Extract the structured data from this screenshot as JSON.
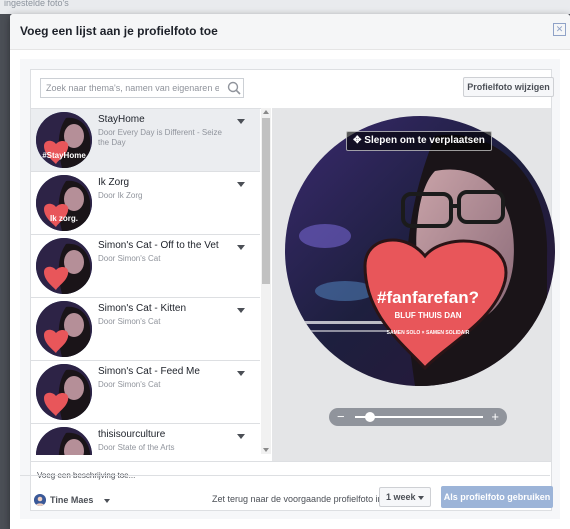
{
  "backdrop": {
    "text": "ingestelde foto's"
  },
  "dialog": {
    "title": "Voeg een lijst aan je profielfoto toe",
    "close_glyph": "✕"
  },
  "search": {
    "placeholder": "Zoek naar thema's, namen van eigenaren en meer"
  },
  "change_photo_button": "Profielfoto wijzigen",
  "frames": [
    {
      "title": "StayHome",
      "subtitle": "Door Every Day is Different - Seize the Day",
      "badge": "#StayHome",
      "selected": true
    },
    {
      "title": "Ik Zorg",
      "subtitle": "Door Ik Zorg",
      "badge": "Ik zorg.",
      "selected": false
    },
    {
      "title": "Simon's Cat - Off to the Vet",
      "subtitle": "Door Simon's Cat",
      "badge": "",
      "selected": false
    },
    {
      "title": "Simon's Cat - Kitten",
      "subtitle": "Door Simon's Cat",
      "badge": "",
      "selected": false
    },
    {
      "title": "Simon's Cat - Feed Me",
      "subtitle": "Door Simon's Cat",
      "badge": "",
      "selected": false
    },
    {
      "title": "thisisourculture",
      "subtitle": "Door State of the Arts",
      "badge": "",
      "selected": false
    }
  ],
  "preview": {
    "drag_label": "Slepen om te verplaatsen",
    "drag_glyph": "✥",
    "heart_title": "#fanfarefan?",
    "heart_subtitle": "BLUF THUIS DAN",
    "heart_tagline": "SAMEN SOLO × SAMEN SOLIDAIR",
    "zoom_fraction": 0.12,
    "zoom_minus": "−",
    "zoom_plus": "+"
  },
  "description": {
    "placeholder": "Voeg een beschrijving toe..."
  },
  "footer": {
    "user_name": "Tine Maes",
    "revert_label": "Zet terug naar de voorgaande profielfoto in",
    "duration": "1 week",
    "primary_button": "Als profielfoto gebruiken"
  },
  "colors": {
    "accent": "#3b5998",
    "primary_disabled": "#9cb4d8",
    "heart": "#e8565a",
    "panel_border": "#dddfe2"
  }
}
